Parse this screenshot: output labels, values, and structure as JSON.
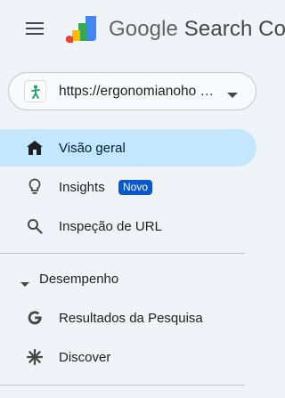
{
  "header": {
    "menu_icon": "hamburger-menu-icon",
    "logo_icon": "search-console-logo-icon",
    "product_google": "Google",
    "product_rest": " Search Co"
  },
  "property": {
    "icon": "accessibility-figure-icon",
    "url": "https://ergonomianoho …",
    "dropdown_icon": "caret-down-icon"
  },
  "nav": {
    "overview": {
      "label": "Visão geral",
      "icon": "home-icon",
      "active": true
    },
    "insights": {
      "label": "Insights",
      "icon": "lightbulb-icon",
      "badge": "Novo"
    },
    "url_inspection": {
      "label": "Inspeção de URL",
      "icon": "search-icon"
    }
  },
  "performance_section": {
    "label": "Desempenho",
    "icon": "caret-down-icon",
    "items": [
      {
        "label": "Resultados da Pesquisa",
        "icon": "google-g-icon"
      },
      {
        "label": "Discover",
        "icon": "asterisk-icon"
      }
    ]
  },
  "colors": {
    "background": "#f0f4f9",
    "active_item": "#c2e7ff",
    "badge": "#0b57d0",
    "logo_blue": "#4285f4",
    "logo_green": "#34a853",
    "logo_yellow": "#fbbc04",
    "logo_red": "#ea4335"
  }
}
